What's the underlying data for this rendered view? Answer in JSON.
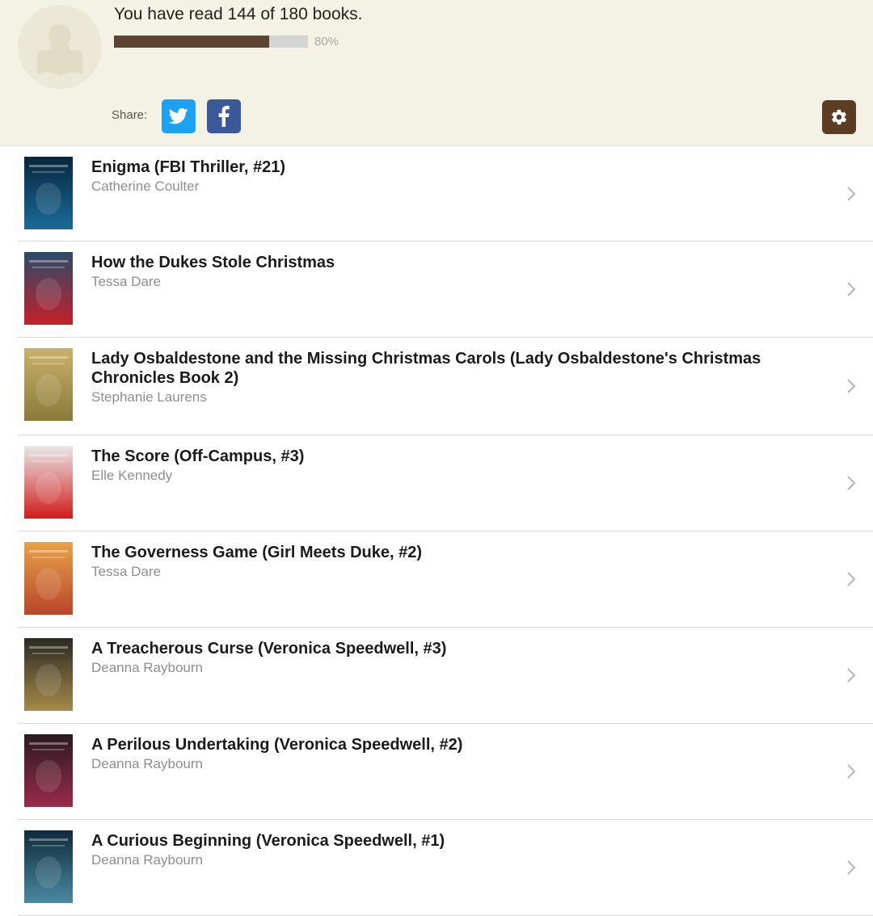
{
  "header": {
    "goal_text": "You have read 144 of 180 books.",
    "progress": {
      "read": 144,
      "total": 180,
      "percent_label": "80%",
      "fraction": 0.8
    },
    "share_label": "Share:",
    "twitter_color": "#1da1f2",
    "facebook_color": "#3b5998",
    "settings_color": "#5c3d24"
  },
  "books": [
    {
      "title": "Enigma (FBI Thriller, #21)",
      "author": "Catherine Coulter",
      "cover": [
        "#08263b",
        "#1a6b9a"
      ],
      "cover_text": "ENIGMA"
    },
    {
      "title": "How the Dukes Stole Christmas",
      "author": "Tessa Dare",
      "cover": [
        "#2a4a6a",
        "#c4202a"
      ],
      "cover_text": "Dukes"
    },
    {
      "title": "Lady Osbaldestone and the Missing Christmas Carols (Lady Osbaldestone's Christmas Chronicles Book 2)",
      "author": "Stephanie Laurens",
      "cover": [
        "#c9b16a",
        "#8a7a3a"
      ],
      "cover_text": "LAURENS"
    },
    {
      "title": "The Score (Off-Campus, #3)",
      "author": "Elle Kennedy",
      "cover": [
        "#e8e8e8",
        "#d11b1b"
      ],
      "cover_text": "THE SCORE"
    },
    {
      "title": "The Governess Game (Girl Meets Duke, #2)",
      "author": "Tessa Dare",
      "cover": [
        "#e8a24a",
        "#b8452a"
      ],
      "cover_text": "Game"
    },
    {
      "title": "A Treacherous Curse (Veronica Speedwell, #3)",
      "author": "Deanna Raybourn",
      "cover": [
        "#2a2a22",
        "#a58a4a"
      ],
      "cover_text": "CURSE"
    },
    {
      "title": "A Perilous Undertaking (Veronica Speedwell, #2)",
      "author": "Deanna Raybourn",
      "cover": [
        "#2a1a22",
        "#9a2a4a"
      ],
      "cover_text": "PERILOUS"
    },
    {
      "title": "A Curious Beginning (Veronica Speedwell, #1)",
      "author": "Deanna Raybourn",
      "cover": [
        "#0e2a3a",
        "#4a8aa0"
      ],
      "cover_text": "CURIOUS"
    }
  ]
}
